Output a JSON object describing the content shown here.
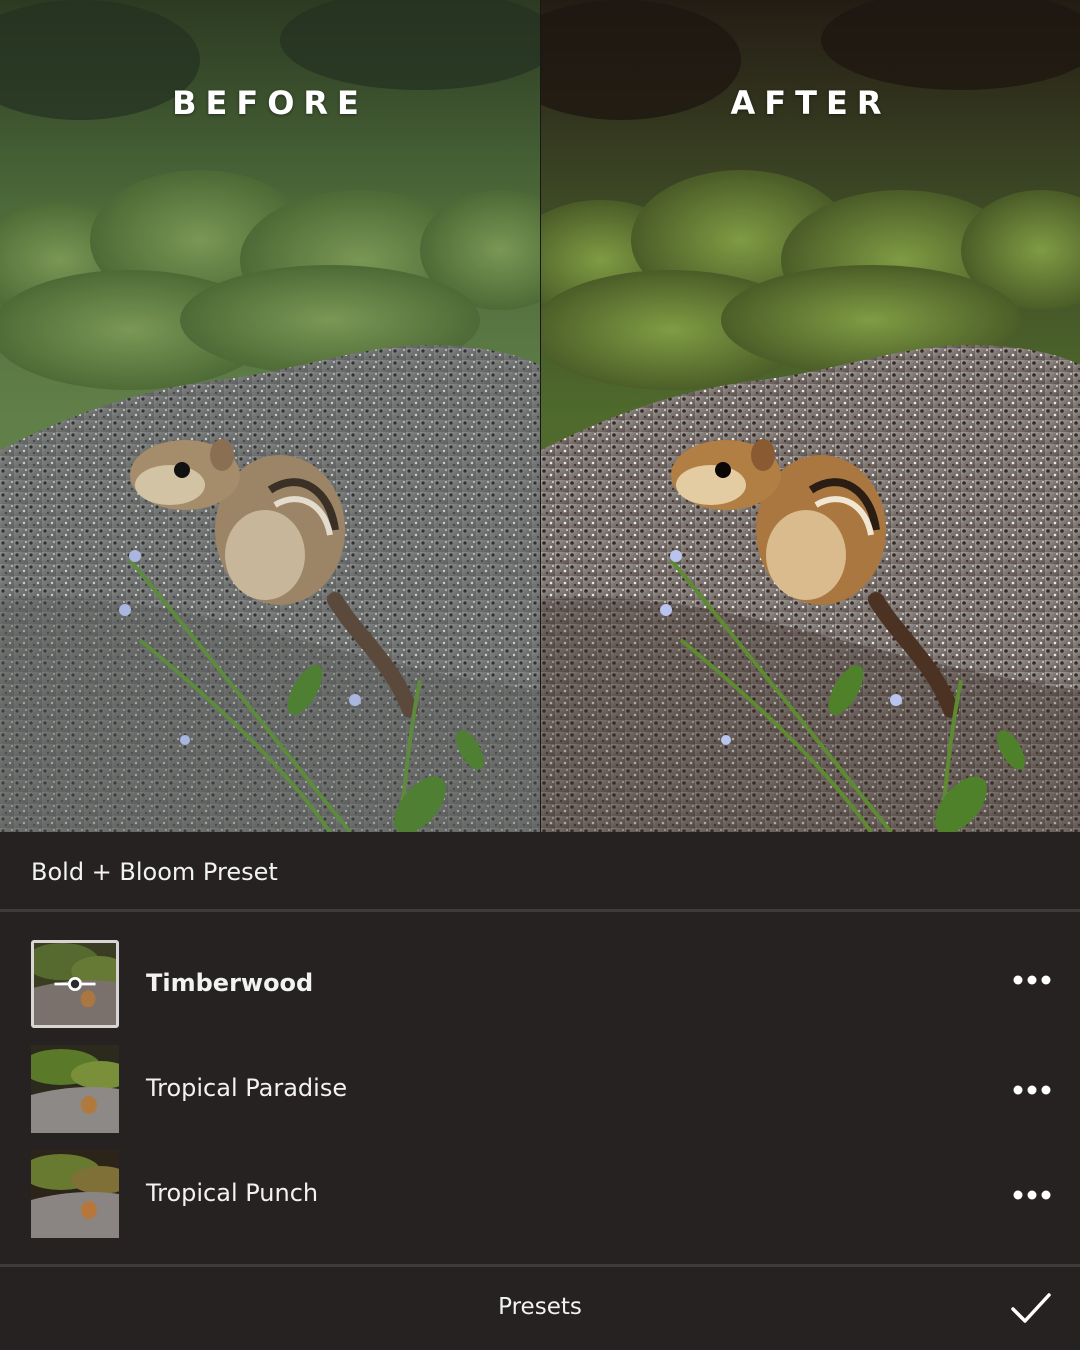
{
  "comparison": {
    "before_label": "BEFORE",
    "after_label": "AFTER"
  },
  "preset_group": {
    "title": "Bold + Bloom Preset"
  },
  "presets": [
    {
      "name": "Timberwood",
      "selected": true,
      "more_icon": "more-horizontal-icon",
      "adjust_icon": "slider-adjust-icon"
    },
    {
      "name": "Tropical Paradise",
      "selected": false,
      "more_icon": "more-horizontal-icon"
    },
    {
      "name": "Tropical Punch",
      "selected": false,
      "more_icon": "more-horizontal-icon"
    }
  ],
  "bottom_bar": {
    "title": "Presets",
    "confirm_icon": "checkmark-icon"
  },
  "colors": {
    "panel_background": "#262222",
    "divider": "#3f3b3b",
    "text": "#f2f2f2"
  }
}
